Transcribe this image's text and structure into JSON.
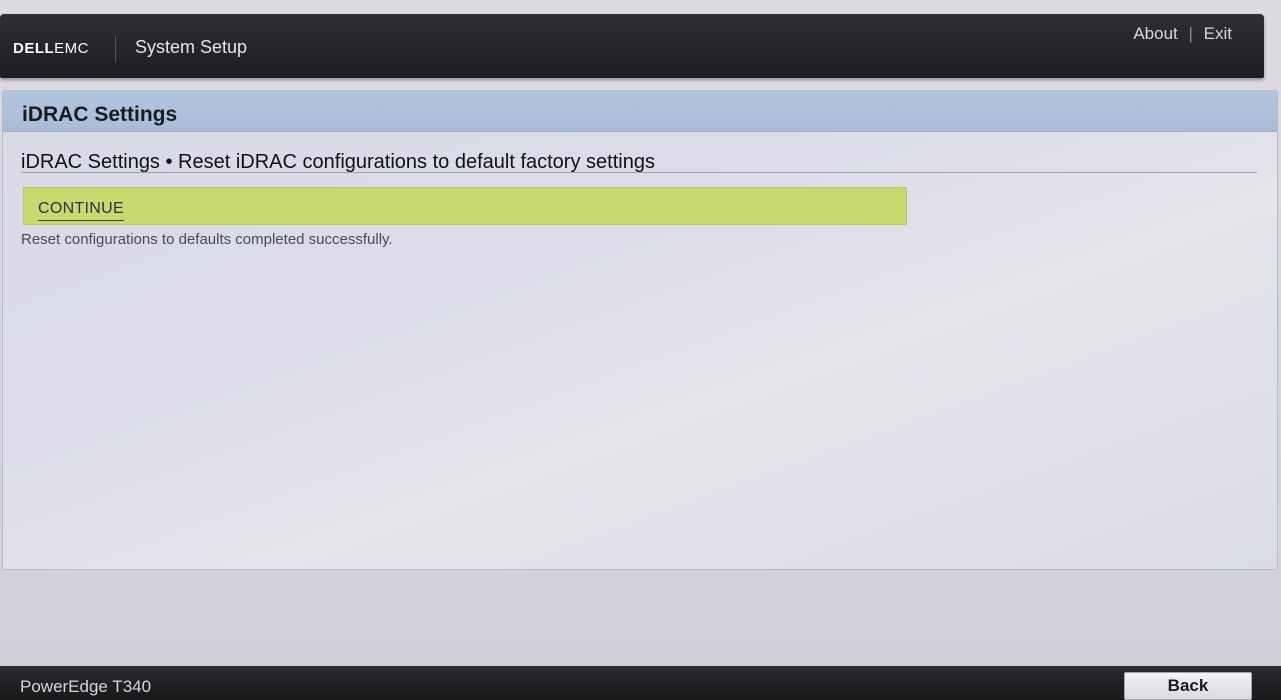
{
  "header": {
    "brand_dell": "DELL",
    "brand_emc": "EMC",
    "title": "System Setup",
    "links": {
      "about": "About",
      "separator": "|",
      "exit": "Exit"
    }
  },
  "panel": {
    "title": "iDRAC Settings",
    "heading": "iDRAC Settings • Reset iDRAC configurations to default factory settings",
    "continue_label": "CONTINUE",
    "status_message": "Reset configurations to defaults completed successfully."
  },
  "footer": {
    "model": "PowerEdge T340",
    "back_label": "Back"
  },
  "colors": {
    "header_bg": "#1c1d20",
    "panel_header_bg": "#aec1dc",
    "selected_row_bg": "#c9d970",
    "footer_bg": "#1c1d20"
  }
}
